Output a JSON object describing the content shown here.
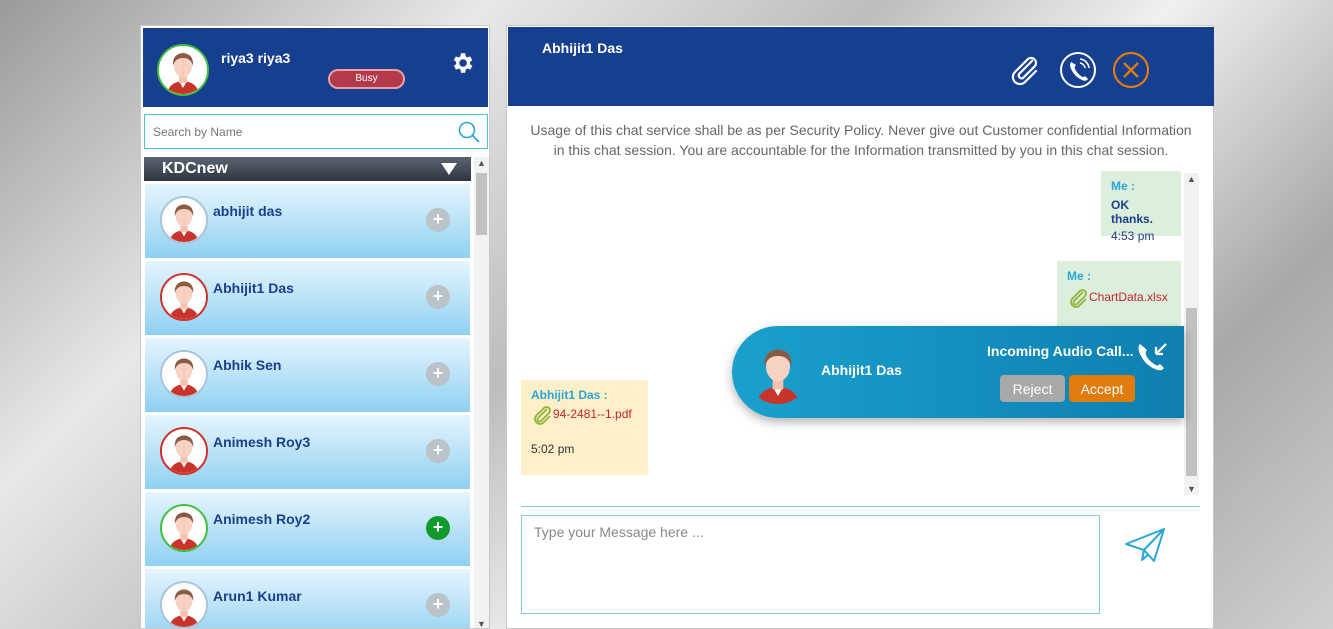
{
  "profile": {
    "name": "riya3 riya3",
    "status": "Busy"
  },
  "search": {
    "placeholder": "Search by Name"
  },
  "group": {
    "name": "KDCnew"
  },
  "contacts": [
    {
      "name": "abhijit das",
      "ring": "grey",
      "action": "grey"
    },
    {
      "name": "Abhijit1 Das",
      "ring": "red",
      "action": "grey"
    },
    {
      "name": "Abhik Sen",
      "ring": "grey",
      "action": "grey"
    },
    {
      "name": "Animesh Roy3",
      "ring": "red",
      "action": "grey"
    },
    {
      "name": "Animesh Roy2",
      "ring": "green",
      "action": "green"
    },
    {
      "name": "Arun1 Kumar",
      "ring": "grey",
      "action": "grey"
    }
  ],
  "chat": {
    "title": "Abhijit1 Das",
    "disclaimer_line1": "Usage of this chat service shall be as per Security Policy. Never give out Customer confidential Information",
    "disclaimer_line2": "in this chat session. You are accountable for the Information transmitted by you in this chat session.",
    "messages": [
      {
        "sender": "Me :",
        "text": "OK thanks.",
        "time": "4:53 pm"
      },
      {
        "sender": "Me :",
        "file": "ChartData.xlsx"
      },
      {
        "sender": "Abhijit1 Das :",
        "file": "94-2481--1.pdf",
        "time": "5:02 pm"
      }
    ],
    "compose_placeholder": "Type your Message here ..."
  },
  "call": {
    "caller": "Abhijit1 Das",
    "label": "Incoming Audio Call...",
    "reject": "Reject",
    "accept": "Accept"
  },
  "colors": {
    "header": "#173f8f",
    "accent": "#e07b0e",
    "call_bg": "#1aa0cc"
  }
}
